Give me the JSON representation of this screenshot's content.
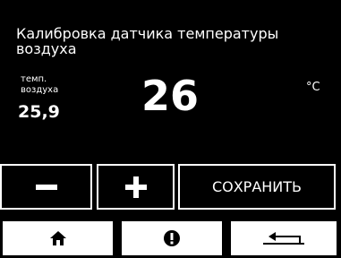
{
  "screen": {
    "title": "Калибровка датчика температуры воздуха"
  },
  "measurement": {
    "label_line1": "темп.",
    "label_line2": "воздуха",
    "value": "25,9"
  },
  "setpoint": {
    "value": "26",
    "unit": "°C"
  },
  "buttons": {
    "decrease_icon": "minus-icon",
    "increase_icon": "plus-icon",
    "save_label": "СОХРАНИТЬ"
  },
  "nav": {
    "home_icon": "home-icon",
    "info_icon": "info-icon",
    "back_icon": "back-arrow-icon"
  },
  "colors": {
    "background": "#000000",
    "foreground": "#ffffff"
  }
}
